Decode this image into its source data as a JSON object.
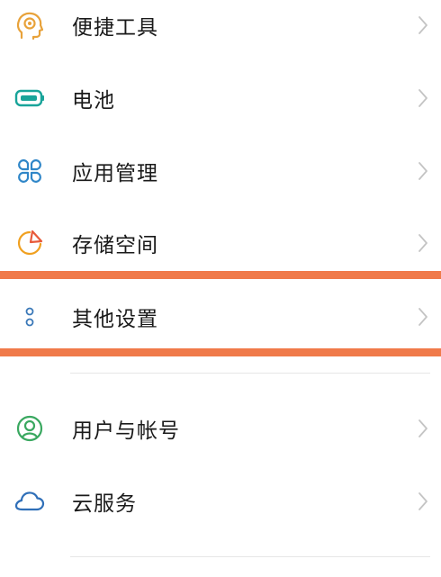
{
  "settings": {
    "items": [
      {
        "label": "便捷工具",
        "icon": "smart-assistant-icon",
        "color": "#e8a23a"
      },
      {
        "label": "电池",
        "icon": "battery-icon",
        "color": "#19a49a"
      },
      {
        "label": "应用管理",
        "icon": "app-grid-icon",
        "color": "#2f86c8"
      },
      {
        "label": "存储空间",
        "icon": "storage-pie-icon",
        "color": "#f0a020"
      },
      {
        "label": "其他设置",
        "icon": "more-dots-icon",
        "color": "#3a78b8"
      },
      {
        "label": "用户与帐号",
        "icon": "user-account-icon",
        "color": "#3aa860"
      },
      {
        "label": "云服务",
        "icon": "cloud-icon",
        "color": "#2f6fb8"
      }
    ]
  },
  "highlight": {
    "color": "#f07a4a"
  }
}
